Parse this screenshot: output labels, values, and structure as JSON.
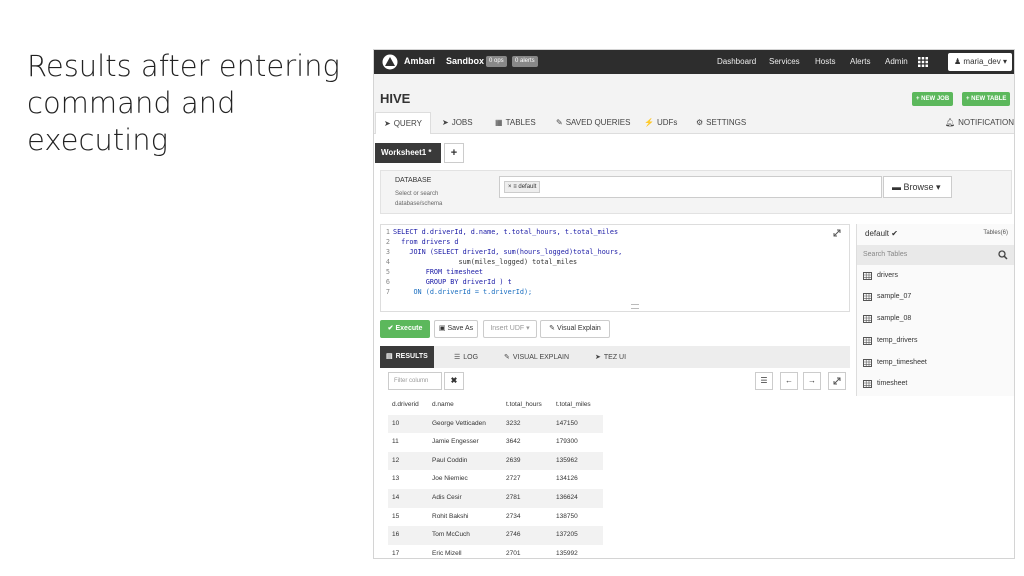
{
  "slide": {
    "title_lines": [
      "Results after entering",
      "command and",
      "executing"
    ]
  },
  "topbar": {
    "brand": "Ambari",
    "cluster": "Sandbox",
    "ops_badge": "0 ops",
    "alerts_badge": "0 alerts",
    "nav": [
      "Dashboard",
      "Services",
      "Hosts",
      "Alerts",
      "Admin"
    ],
    "user": "maria_dev"
  },
  "hive": {
    "title": "HIVE",
    "new_job": "+ NEW JOB",
    "new_table": "+ NEW TABLE",
    "tabs": [
      "QUERY",
      "JOBS",
      "TABLES",
      "SAVED QUERIES",
      "UDFs",
      "SETTINGS"
    ],
    "notifications": "NOTIFICATIONS"
  },
  "worksheet": {
    "tab": "Worksheet1 *",
    "add": "+"
  },
  "database": {
    "label": "DATABASE",
    "help": "Select or search database/schema",
    "selected": "default",
    "browse": "Browse"
  },
  "editor": {
    "lines": [
      {
        "n": "1",
        "t": "SELECT d.driverId, d.name, t.total_hours, t.total_miles"
      },
      {
        "n": "2",
        "t": "  from drivers d"
      },
      {
        "n": "3",
        "t": "    JOIN (SELECT driverId, sum(hours_logged)total_hours,"
      },
      {
        "n": "4",
        "t": "                sum(miles_logged) total_miles"
      },
      {
        "n": "5",
        "t": "        FROM timesheet"
      },
      {
        "n": "6",
        "t": "        GROUP BY driverId ) t"
      },
      {
        "n": "7",
        "t": "     ON (d.driverId = t.driverId);"
      }
    ]
  },
  "tables_panel": {
    "db": "default",
    "count": "Tables(6)",
    "search_placeholder": "Search Tables",
    "tables": [
      "drivers",
      "sample_07",
      "sample_08",
      "temp_drivers",
      "temp_timesheet",
      "timesheet"
    ]
  },
  "actions": {
    "execute": "Execute",
    "save_as": "Save As",
    "insert_udf": "Insert UDF",
    "visual_explain": "Visual Explain"
  },
  "result_tabs": [
    "RESULTS",
    "LOG",
    "VISUAL EXPLAIN",
    "TEZ UI"
  ],
  "filter": {
    "placeholder": "Filter column"
  },
  "results": {
    "columns": [
      "d.driverid",
      "d.name",
      "t.total_hours",
      "t.total_miles"
    ],
    "rows": [
      [
        "10",
        "George Vetticaden",
        "3232",
        "147150"
      ],
      [
        "11",
        "Jamie Engesser",
        "3642",
        "179300"
      ],
      [
        "12",
        "Paul Coddin",
        "2639",
        "135962"
      ],
      [
        "13",
        "Joe Niemiec",
        "2727",
        "134126"
      ],
      [
        "14",
        "Adis Cesir",
        "2781",
        "136624"
      ],
      [
        "15",
        "Rohit Bakshi",
        "2734",
        "138750"
      ],
      [
        "16",
        "Tom McCuch",
        "2746",
        "137205"
      ],
      [
        "17",
        "Eric Mizell",
        "2701",
        "135992"
      ]
    ]
  }
}
